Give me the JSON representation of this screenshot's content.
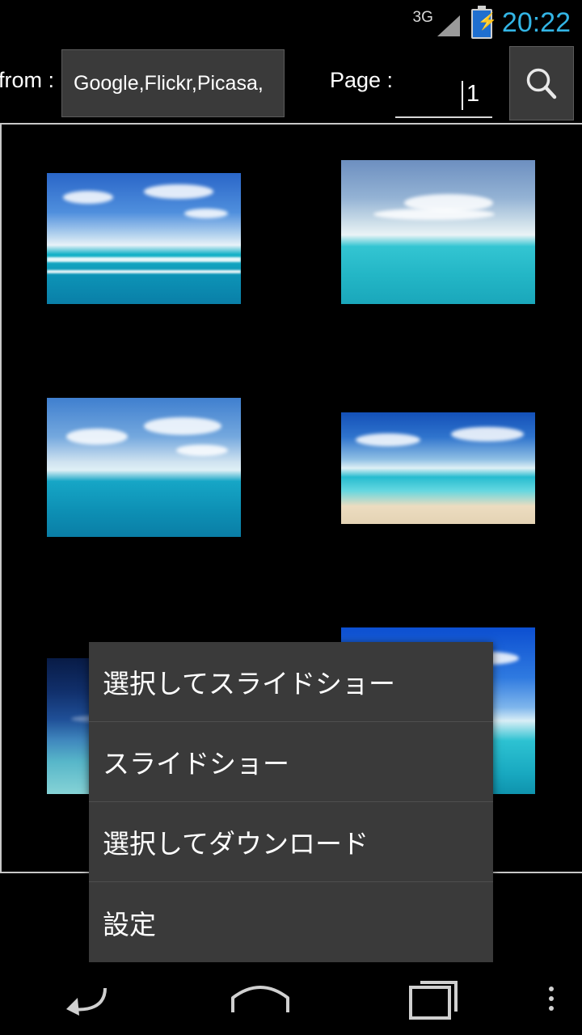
{
  "status_bar": {
    "network_type": "3G",
    "clock": "20:22",
    "signal_icon": "signal-bars-icon",
    "battery_icon": "battery-charging-icon"
  },
  "toolbar": {
    "from_label": "from :",
    "source_value": "Google,Flickr,Picasa,",
    "page_label": "Page :",
    "page_value": "1",
    "search_icon": "search-icon"
  },
  "gallery": {
    "items": [
      {
        "name": "thumbnail-1",
        "alt": "tropical reef with white clouds"
      },
      {
        "name": "thumbnail-2",
        "alt": "pale sky over turquoise sea"
      },
      {
        "name": "thumbnail-3",
        "alt": "blue sky clouds over deep blue ocean"
      },
      {
        "name": "thumbnail-4",
        "alt": "beach with white sand and blue sea"
      },
      {
        "name": "thumbnail-5",
        "alt": "night-blue seascape"
      },
      {
        "name": "thumbnail-6",
        "alt": "bright blue sea and sky"
      }
    ]
  },
  "context_menu": {
    "items": [
      {
        "label": "選択してスライドショー",
        "name": "menu-item-select-slideshow"
      },
      {
        "label": "スライドショー",
        "name": "menu-item-slideshow"
      },
      {
        "label": "選択してダウンロード",
        "name": "menu-item-select-download"
      },
      {
        "label": "設定",
        "name": "menu-item-settings"
      }
    ]
  },
  "nav_bar": {
    "back": "back-icon",
    "home": "home-icon",
    "recents": "recents-icon",
    "overflow": "overflow-menu-icon"
  },
  "colors": {
    "accent": "#33b5e5",
    "panel": "#3a3a3a",
    "background": "#000000"
  }
}
